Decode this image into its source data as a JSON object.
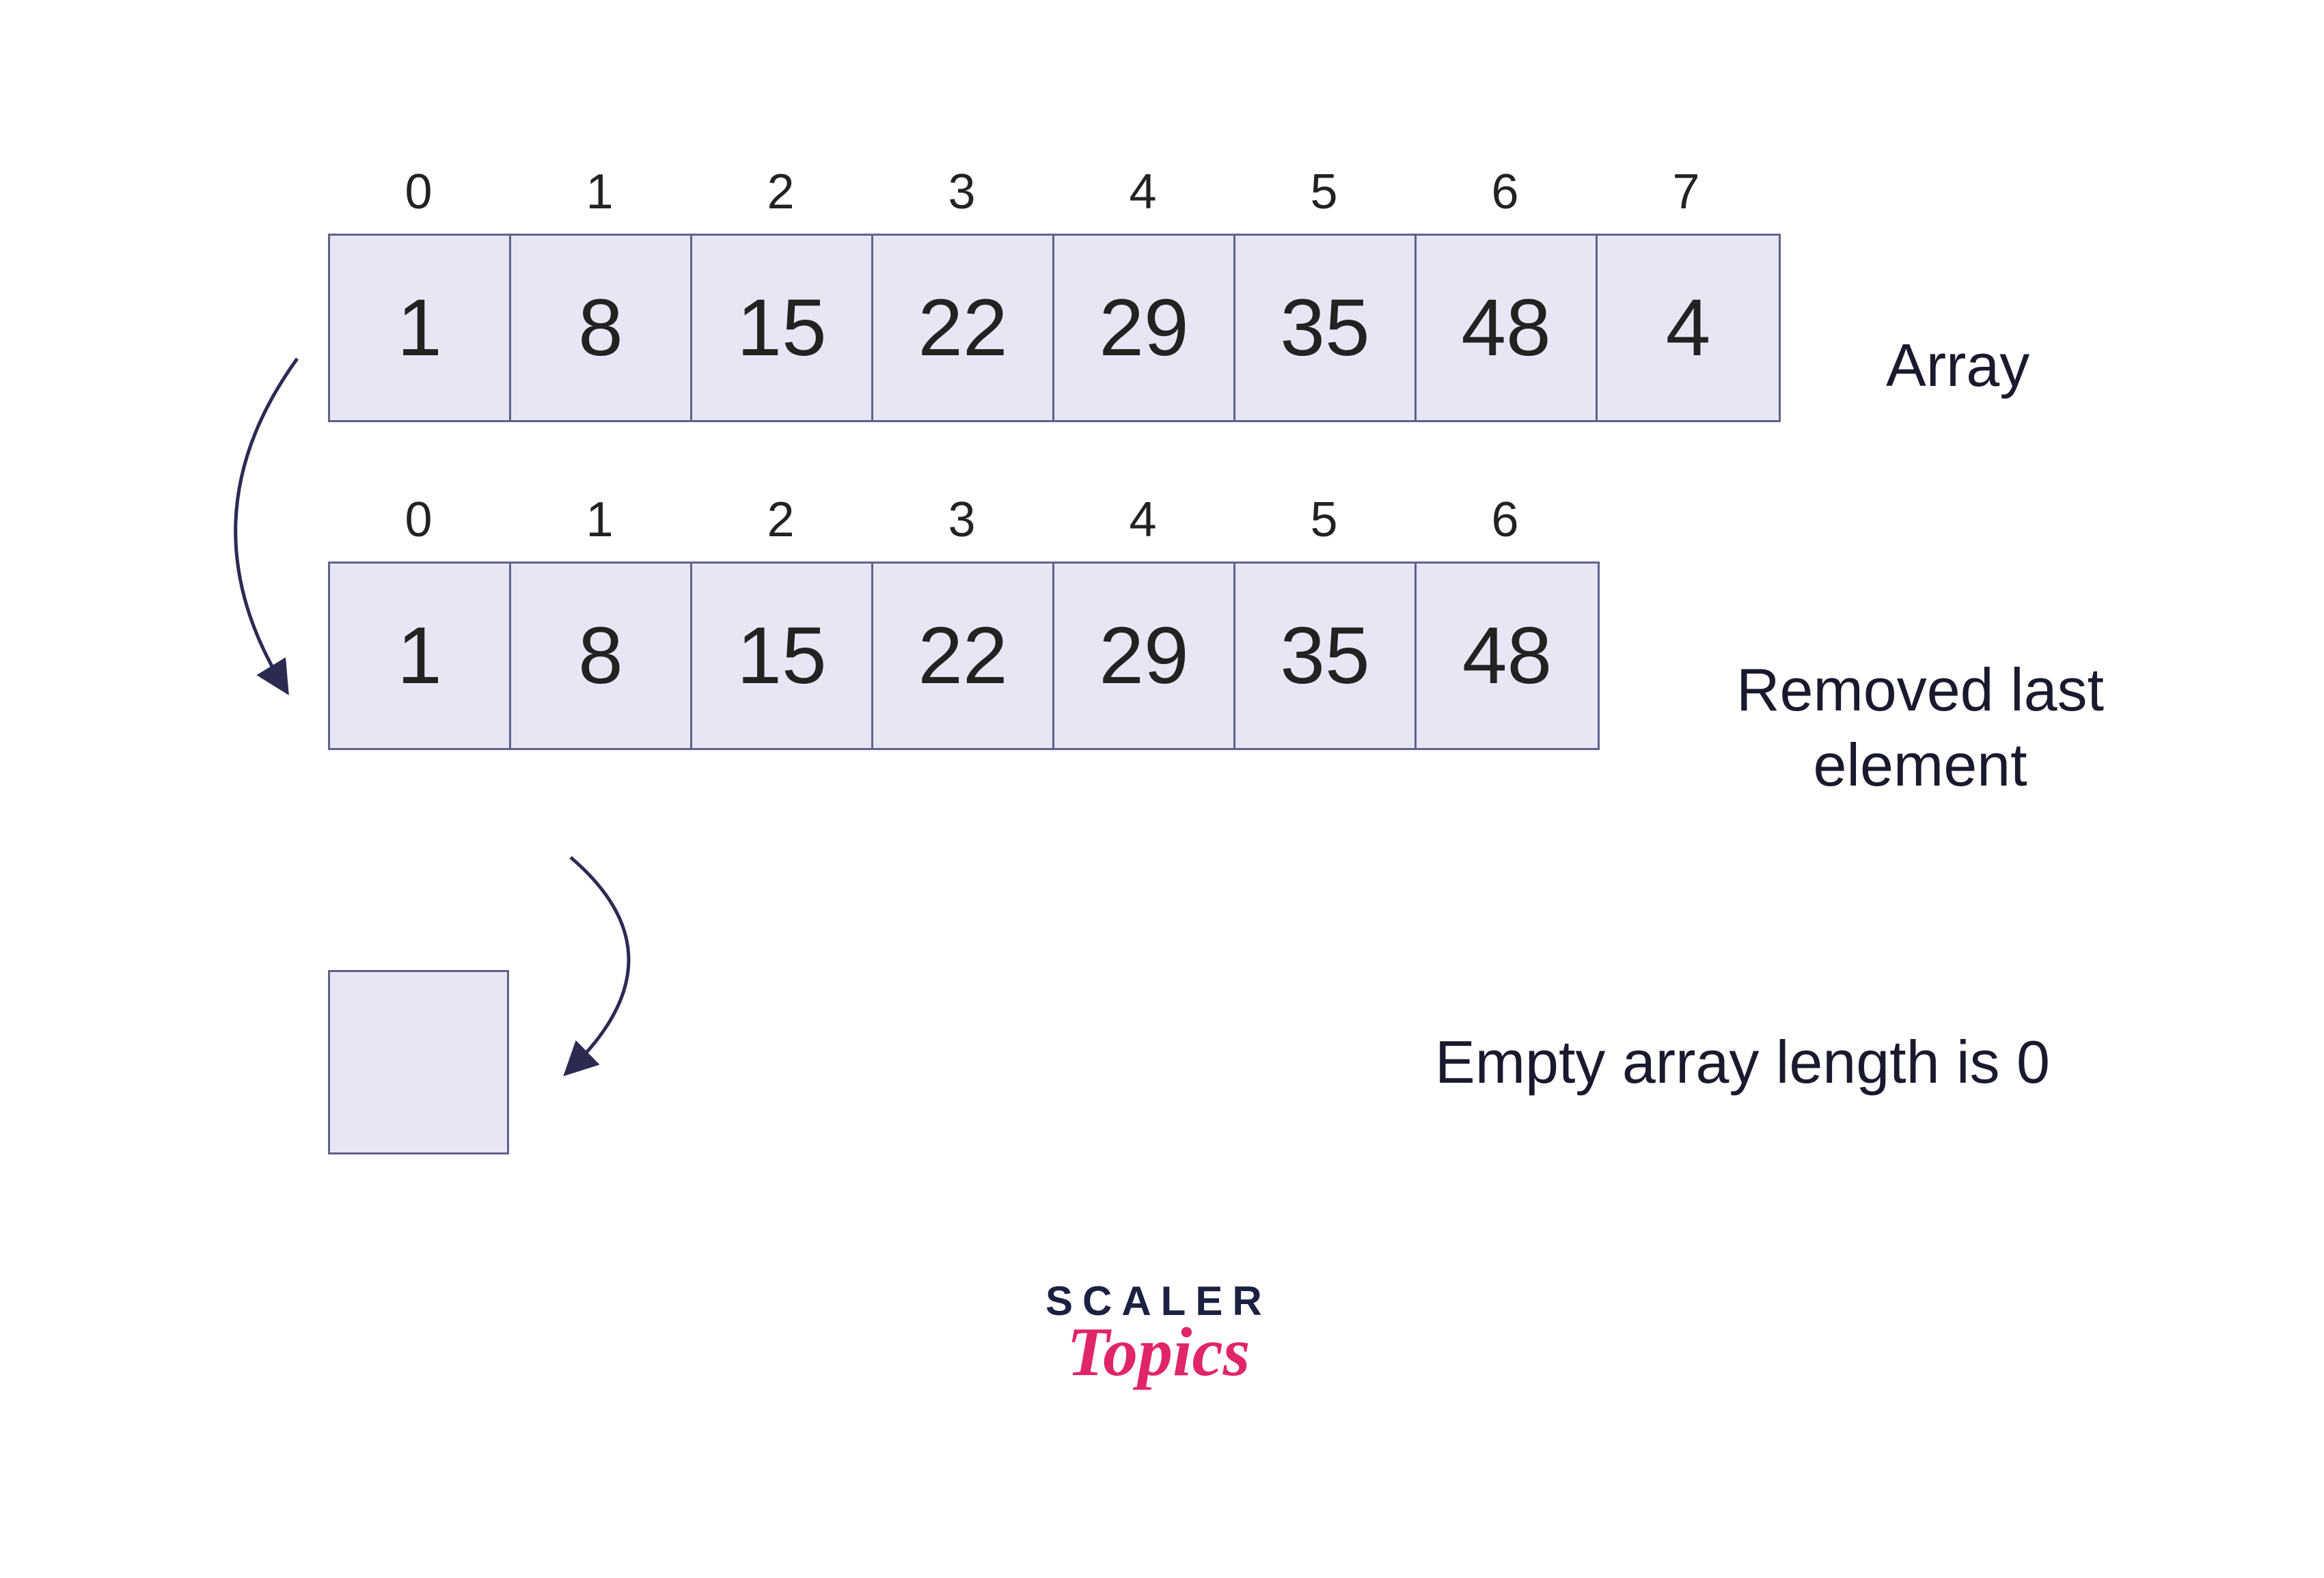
{
  "arrays": {
    "first": {
      "indices": [
        "0",
        "1",
        "2",
        "3",
        "4",
        "5",
        "6",
        "7"
      ],
      "values": [
        "1",
        "8",
        "15",
        "22",
        "29",
        "35",
        "48",
        "4"
      ],
      "label": "Array"
    },
    "second": {
      "indices": [
        "0",
        "1",
        "2",
        "3",
        "4",
        "5",
        "6"
      ],
      "values": [
        "1",
        "8",
        "15",
        "22",
        "29",
        "35",
        "48"
      ],
      "label": "Removed last\nelement"
    },
    "third": {
      "label": "Empty array length is 0"
    }
  },
  "brand": {
    "line1": "SCALER",
    "line2": "Topics"
  },
  "colors": {
    "cell_fill": "#e6e6f5",
    "cell_border": "#61618c",
    "arrow": "#2b2b52",
    "brand_primary": "#1b2140",
    "brand_accent": "#e0256b"
  }
}
